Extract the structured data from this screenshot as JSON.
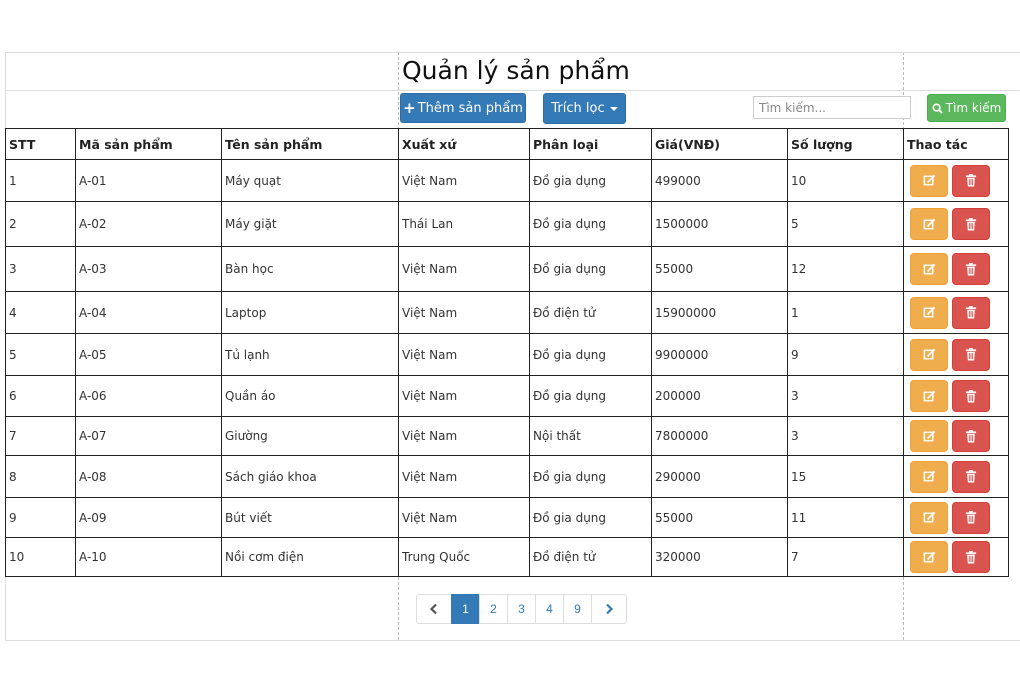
{
  "page": {
    "title": "Quản lý sản phẩm"
  },
  "toolbar": {
    "add_label": "Thêm sản phẩm",
    "filter_label": "Trích lọc",
    "search_placeholder": "Tìm kiếm...",
    "search_value": "",
    "search_button_label": "Tìm kiếm"
  },
  "colors": {
    "primary": "#337ab7",
    "success": "#5cb85c",
    "warning": "#f0ad4e",
    "danger": "#d9534f"
  },
  "table": {
    "headers": [
      "STT",
      "Mã sản phẩm",
      "Tên sản phẩm",
      "Xuất xứ",
      "Phân loại",
      "Giá(VNĐ)",
      "Số lượng",
      "Thao tác"
    ],
    "rows": [
      {
        "stt": "1",
        "code": "A-01",
        "name": "Máy quạt",
        "origin": "Việt Nam",
        "category": "Đồ gia dụng",
        "price": "499000",
        "qty": "10"
      },
      {
        "stt": "2",
        "code": "A-02",
        "name": "Máy giặt",
        "origin": "Thái Lan",
        "category": "Đồ gia dụng",
        "price": "1500000",
        "qty": "5"
      },
      {
        "stt": "3",
        "code": "A-03",
        "name": "Bàn học",
        "origin": "Việt Nam",
        "category": "Đồ gia dụng",
        "price": "55000",
        "qty": "12"
      },
      {
        "stt": "4",
        "code": "A-04",
        "name": "Laptop",
        "origin": "Việt Nam",
        "category": "Đồ điện tử",
        "price": "15900000",
        "qty": "1"
      },
      {
        "stt": "5",
        "code": "A-05",
        "name": "Tủ lạnh",
        "origin": "Việt Nam",
        "category": "Đồ gia dụng",
        "price": "9900000",
        "qty": "9"
      },
      {
        "stt": "6",
        "code": "A-06",
        "name": "Quần áo",
        "origin": "Việt Nam",
        "category": "Đồ gia dụng",
        "price": "200000",
        "qty": "3"
      },
      {
        "stt": "7",
        "code": "A-07",
        "name": "Giường",
        "origin": "Việt Nam",
        "category": "Nội thất",
        "price": "7800000",
        "qty": "3"
      },
      {
        "stt": "8",
        "code": "A-08",
        "name": "Sách giáo khoa",
        "origin": "Việt Nam",
        "category": "Đồ gia dụng",
        "price": "290000",
        "qty": "15"
      },
      {
        "stt": "9",
        "code": "A-09",
        "name": "Bút viết",
        "origin": "Việt Nam",
        "category": "Đồ gia dụng",
        "price": "55000",
        "qty": "11"
      },
      {
        "stt": "10",
        "code": "A-10",
        "name": "Nồi cơm điện",
        "origin": "Trung Quốc",
        "category": "Đồ điện tử",
        "price": "320000",
        "qty": "7"
      }
    ],
    "row_actions": [
      "edit-icon",
      "trash-icon"
    ]
  },
  "pagination": {
    "prev_icon": "chevron-left-icon",
    "next_icon": "chevron-right-icon",
    "pages": [
      "1",
      "2",
      "3",
      "4",
      "9"
    ],
    "current": "1"
  }
}
